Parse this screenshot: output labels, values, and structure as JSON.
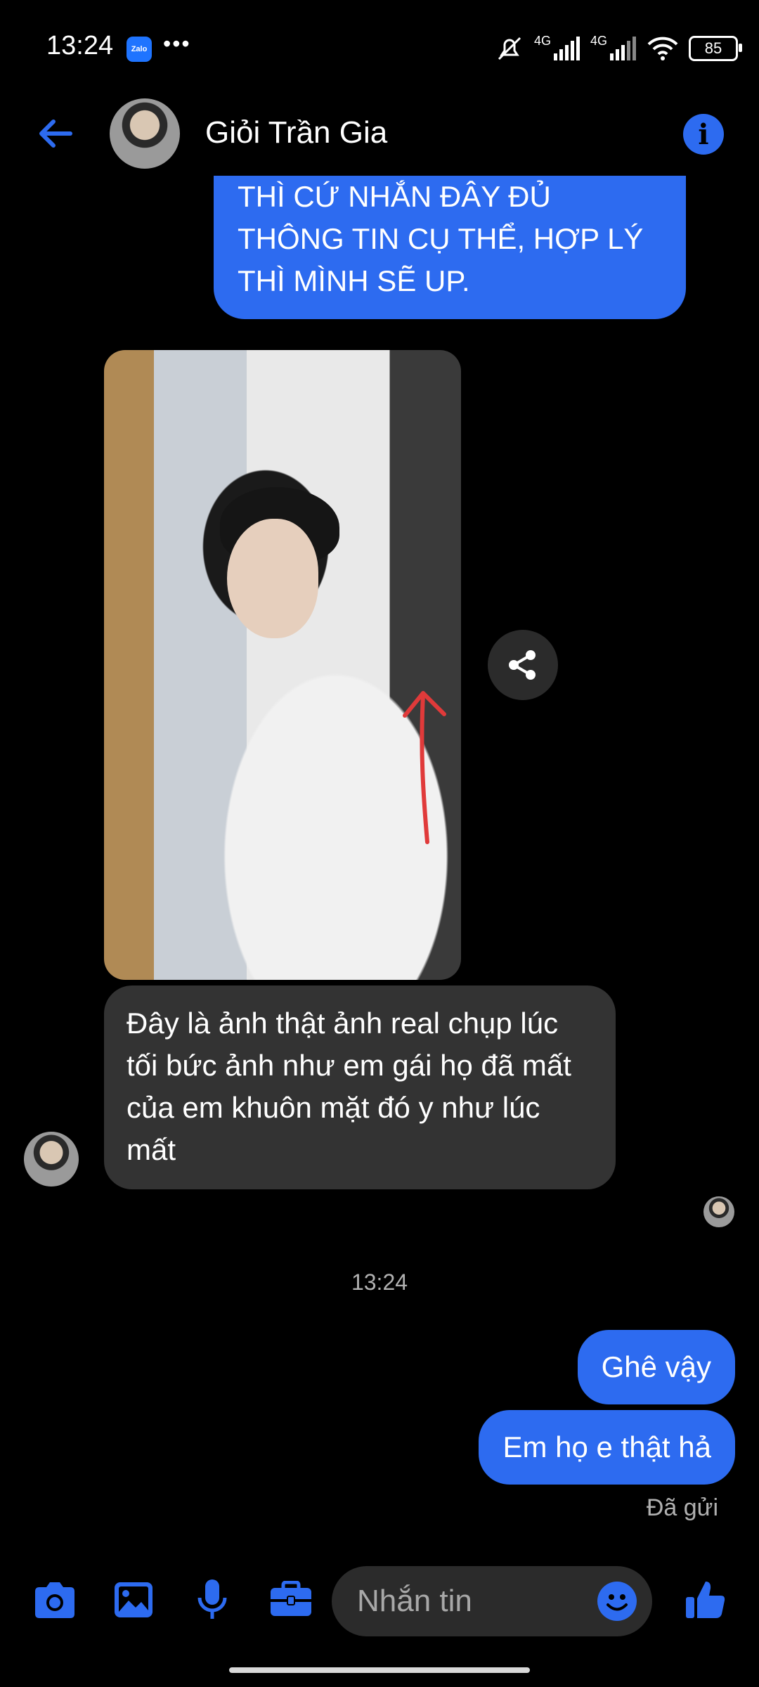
{
  "status_bar": {
    "time": "13:24",
    "app_badge": "Zalo",
    "more": "•••",
    "network_1": "4G",
    "network_2": "4G",
    "battery": "85"
  },
  "header": {
    "contact_name": "Giỏi Trần Gia",
    "back_icon": "back-arrow-icon",
    "info_icon": "info-icon"
  },
  "messages": {
    "outgoing_top": "THÌ CỨ NHẮN ĐÂY ĐỦ THÔNG TIN CỤ THỂ, HỢP LÝ THÌ MÌNH SẼ UP.",
    "incoming_text": "Đây là ảnh thật ảnh real chụp lúc tối bức ảnh như em gái họ đã mất của em khuôn mặt đó y như lúc mất",
    "timestamp": "13:24",
    "outgoing_1": "Ghê vậy",
    "outgoing_2": "Em họ e thật hả",
    "sent_status": "Đã gửi"
  },
  "composer": {
    "placeholder": "Nhắn tin",
    "icons": [
      "camera-icon",
      "gallery-icon",
      "microphone-icon",
      "briefcase-icon",
      "emoji-icon",
      "like-icon"
    ]
  },
  "colors": {
    "accent": "#2d6bf0",
    "incoming_bubble": "#333333",
    "background": "#000000"
  }
}
